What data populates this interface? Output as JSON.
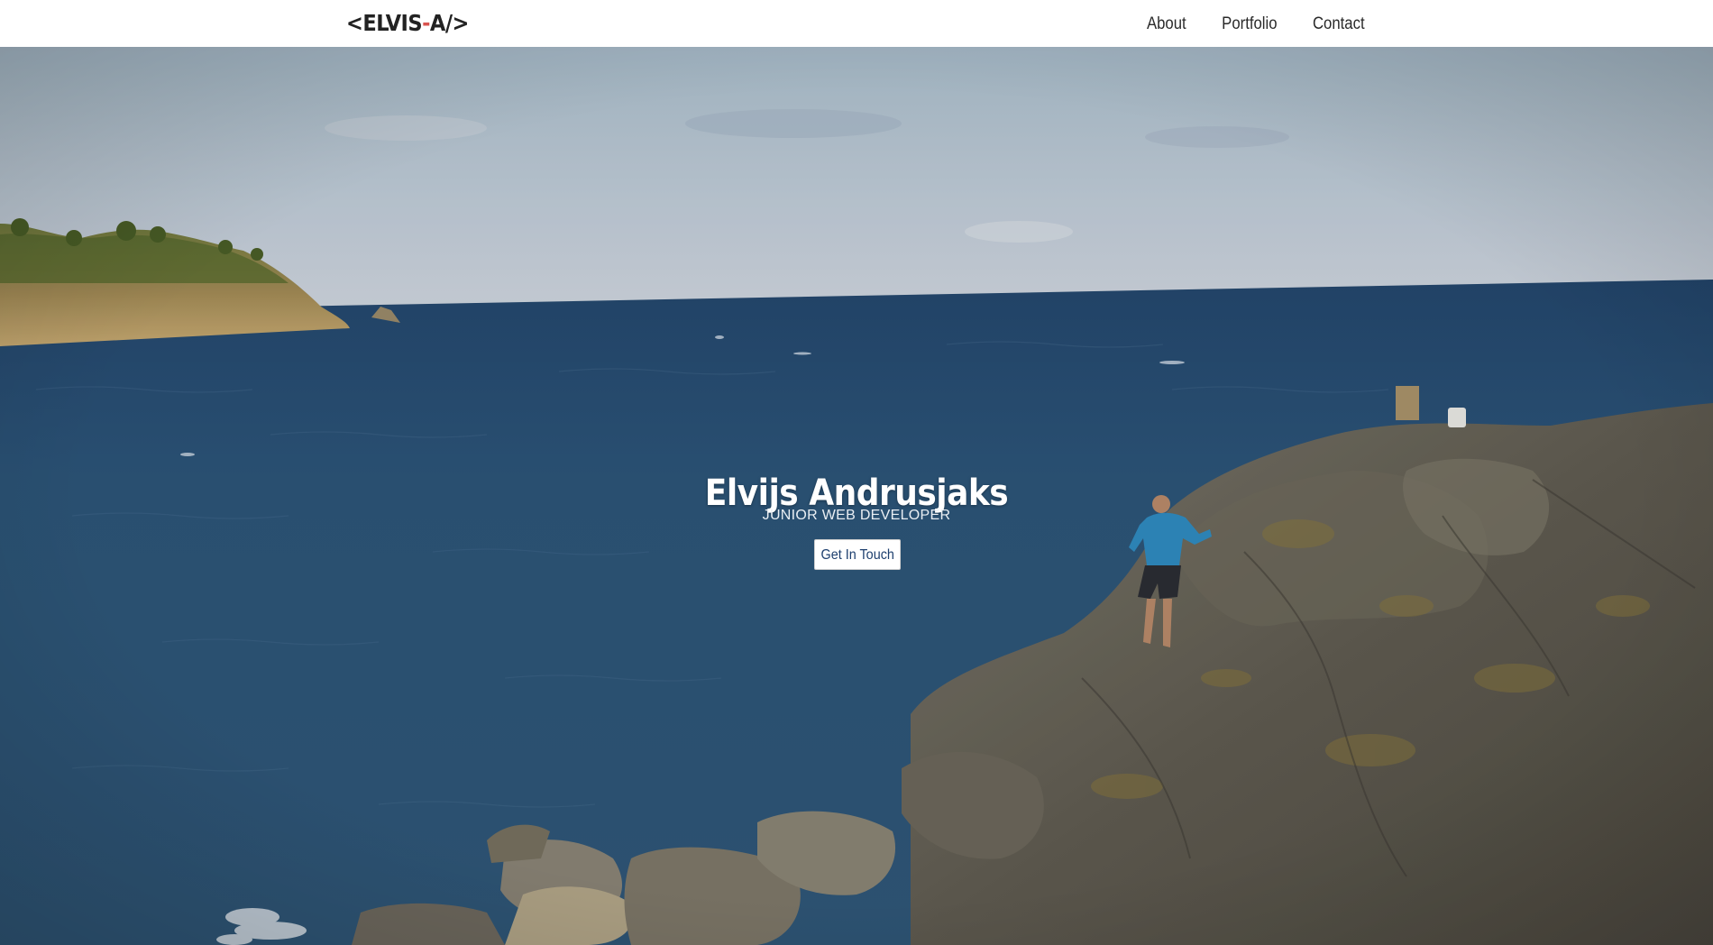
{
  "brand": {
    "prefix": "<ELVIS",
    "dash": "-",
    "suffix": "A/>"
  },
  "nav": {
    "items": [
      "About",
      "Portfolio",
      "Contact"
    ]
  },
  "hero": {
    "name": "Elvijs Andrusjaks",
    "role": "JUNIOR WEB DEVELOPER",
    "cta_label": "Get In Touch",
    "background_description_icon": "sea-rocks-photo"
  },
  "colors": {
    "navbar_bg": "#ffffff",
    "brand_text": "#222222",
    "brand_accent": "#d9534f",
    "cta_text": "#1d3f6e",
    "sea": "#2c5478",
    "sky": "#b7c6d4"
  }
}
